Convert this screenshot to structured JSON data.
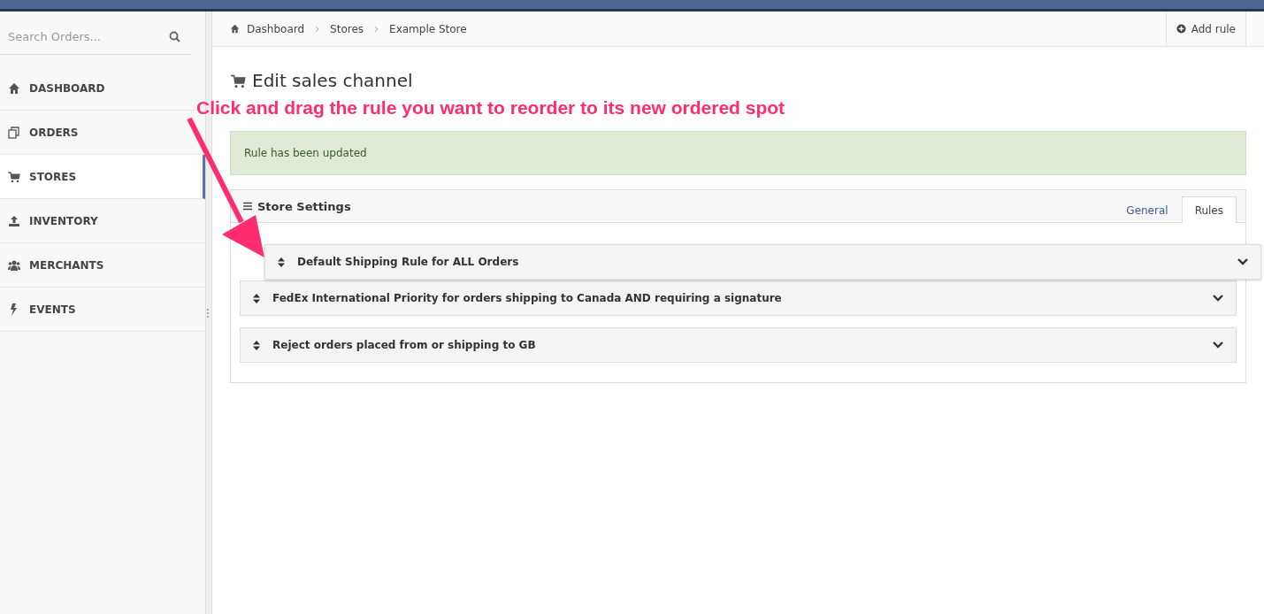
{
  "sidebar": {
    "search": {
      "placeholder": "Search Orders..."
    },
    "items": [
      {
        "label": "DASHBOARD",
        "selected": false
      },
      {
        "label": "ORDERS",
        "selected": false
      },
      {
        "label": "STORES",
        "selected": true
      },
      {
        "label": "INVENTORY",
        "selected": false
      },
      {
        "label": "MERCHANTS",
        "selected": false
      },
      {
        "label": "EVENTS",
        "selected": false
      }
    ]
  },
  "breadcrumb": [
    "Dashboard",
    "Stores",
    "Example Store"
  ],
  "add_rule_button": "Add rule",
  "page_title": "Edit sales channel",
  "annotation": "Click and drag the rule you want to reorder to its new ordered spot",
  "alert": "Rule has been updated",
  "panel": {
    "title": "Store Settings",
    "tabs": [
      {
        "label": "General",
        "selected": false
      },
      {
        "label": "Rules",
        "selected": true
      }
    ],
    "rules": [
      {
        "label": "Default Shipping Rule for ALL Orders",
        "dragging": true
      },
      {
        "label": "FedEx International Priority for orders shipping to Canada AND requiring a signature",
        "dragging": false
      },
      {
        "label": "Reject orders placed from or shipping to GB",
        "dragging": false
      }
    ]
  }
}
